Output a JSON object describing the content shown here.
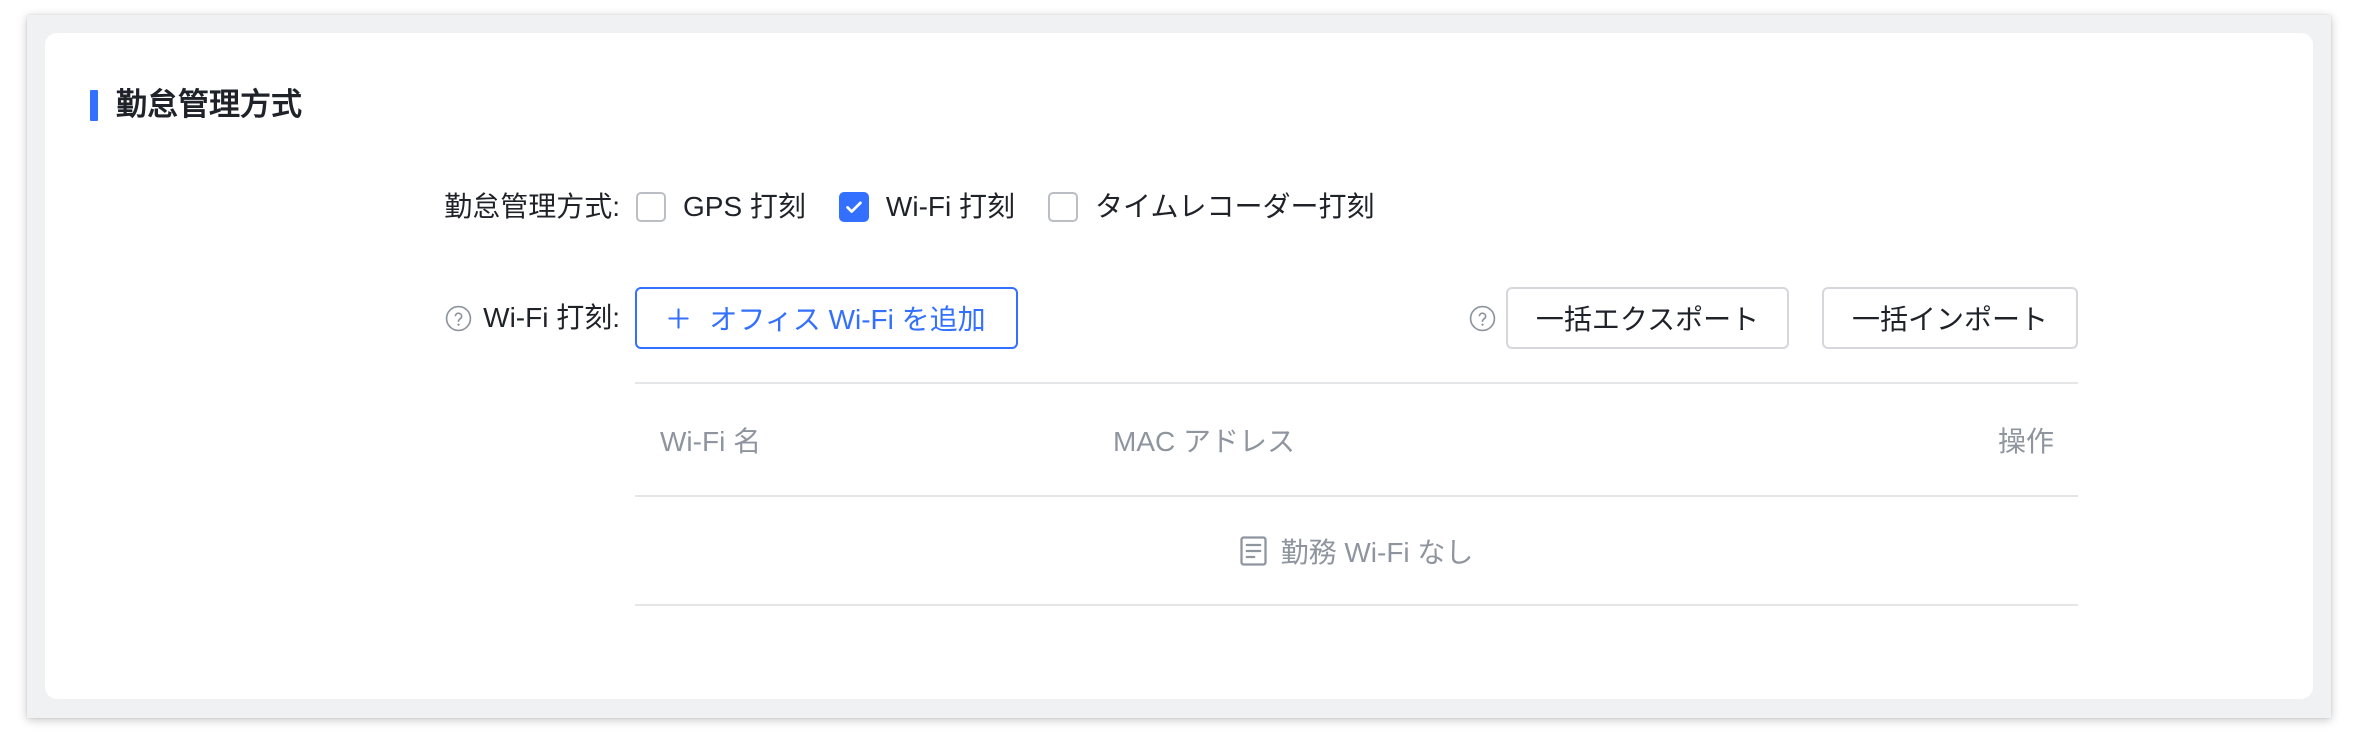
{
  "colors": {
    "accent": "#3370ff",
    "text": "#1f2329",
    "muted": "#8f959e"
  },
  "section": {
    "title": "勤怠管理方式"
  },
  "attendance_method": {
    "label": "勤怠管理方式:",
    "options": [
      {
        "label": "GPS 打刻",
        "checked": false
      },
      {
        "label": "Wi-Fi 打刻",
        "checked": true
      },
      {
        "label": "タイムレコーダー打刻",
        "checked": false
      }
    ]
  },
  "wifi_punch": {
    "label": "Wi-Fi 打刻:",
    "help_icon": "question-circle-icon",
    "add_button": {
      "icon": "plus-icon",
      "label": "オフィス Wi-Fi を追加"
    },
    "bulk_help_icon": "question-circle-icon",
    "export_button": "一括エクスポート",
    "import_button": "一括インポート",
    "table": {
      "columns": [
        "Wi-Fi 名",
        "MAC アドレス",
        "操作"
      ],
      "rows": [],
      "empty": {
        "icon": "document-icon",
        "text": "勤務 Wi-Fi なし"
      }
    }
  }
}
